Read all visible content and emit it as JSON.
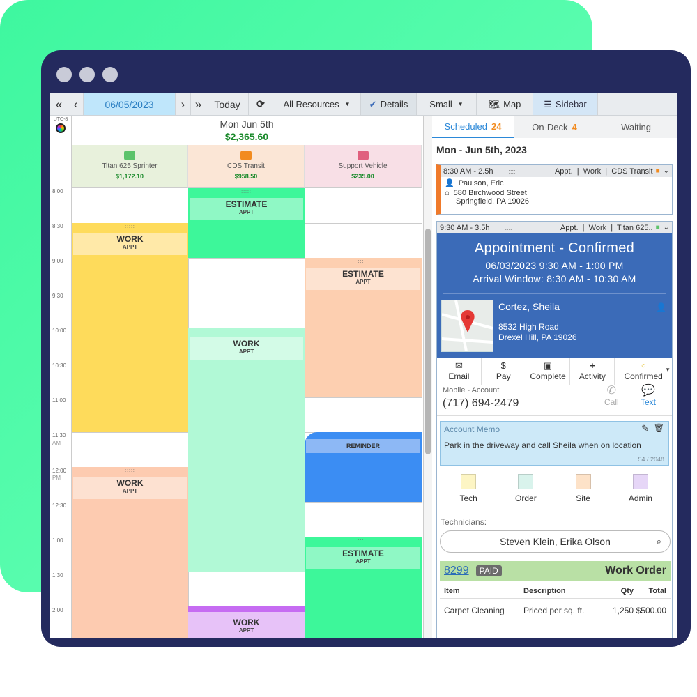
{
  "toolbar": {
    "first": "«",
    "prev": "‹",
    "date": "06/05/2023",
    "next": "›",
    "last": "»",
    "today": "Today",
    "refresh": "⟳",
    "resources": "All Resources",
    "details": "Details",
    "size": "Small",
    "map": "Map",
    "sidebar": "Sidebar"
  },
  "timezone": "UTC-8",
  "day": {
    "label": "Mon Jun 5th",
    "total": "$2,365.60"
  },
  "resources": [
    {
      "name": "Titan 625 Sprinter",
      "amount": "$1,172.10",
      "color": "#5cc36b"
    },
    {
      "name": "CDS Transit",
      "amount": "$958.50",
      "color": "#f28b1f"
    },
    {
      "name": "Support Vehicle",
      "amount": "$235.00",
      "color": "#e0607e"
    }
  ],
  "times": [
    "8:00",
    "8:30",
    "9:00",
    "9:30",
    "10:00",
    "10:30",
    "11:00",
    "11:30",
    "AM",
    "12:00",
    "PM",
    "12:30",
    "1:00",
    "1:30",
    "2:00"
  ],
  "appointments": [
    {
      "title": "ESTIMATE",
      "sub": "APPT"
    },
    {
      "title": "WORK",
      "sub": "APPT"
    },
    {
      "title": "ESTIMATE",
      "sub": "APPT"
    },
    {
      "title": "WORK",
      "sub": "APPT"
    },
    {
      "title": "REMINDER",
      "sub": ""
    },
    {
      "title": "WORK",
      "sub": "APPT"
    },
    {
      "title": "ESTIMATE",
      "sub": "APPT"
    },
    {
      "title": "WORK",
      "sub": "APPT"
    }
  ],
  "tabs": {
    "scheduled": "Scheduled",
    "scheduled_count": "24",
    "ondeck": "On-Deck",
    "ondeck_count": "4",
    "waiting": "Waiting"
  },
  "panel_date": "Mon - Jun 5th, 2023",
  "card1": {
    "time": "8:30 AM - 2.5h",
    "grip": "::::",
    "meta": "Appt.  |  Work  |  CDS Transit",
    "name": "Paulson, Eric",
    "addr1": "580 Birchwood Street",
    "addr2": "Springfield, PA 19026"
  },
  "card2": {
    "time": "9:30 AM - 3.5h",
    "grip": "::::",
    "meta": "Appt.  |  Work  |  Titan 625..",
    "status": "Appointment - Confirmed",
    "datetime": "06/03/2023 9:30 AM - 1:00 PM",
    "window": "Arrival Window: 8:30 AM - 10:30 AM",
    "name": "Cortez, Sheila",
    "addr1": "8532 High Road",
    "addr2": "Drexel Hill, PA 19026"
  },
  "actions": {
    "email": "Email",
    "pay": "Pay",
    "complete": "Complete",
    "activity": "Activity",
    "confirmed": "Confirmed"
  },
  "contact": {
    "label": "Mobile - Account",
    "phone": "(717) 694-2479",
    "call": "Call",
    "text": "Text"
  },
  "memo": {
    "title": "Account Memo",
    "text": "Park in the driveway and call Sheila when on location",
    "count": "54 / 2048"
  },
  "notes": [
    {
      "label": "Tech",
      "color": "#fdf5c4"
    },
    {
      "label": "Order",
      "color": "#d9f3ec"
    },
    {
      "label": "Site",
      "color": "#fde2c8"
    },
    {
      "label": "Admin",
      "color": "#e6d6f7"
    }
  ],
  "technicians": {
    "label": "Technicians:",
    "value": "Steven Klein, Erika Olson"
  },
  "workorder": {
    "number": "8299",
    "badge": "PAID",
    "title": "Work Order",
    "headers": [
      "Item",
      "Description",
      "Qty",
      "Total"
    ],
    "row": [
      "Carpet Cleaning",
      "Priced per sq. ft.",
      "1,250",
      "$500.00"
    ]
  }
}
